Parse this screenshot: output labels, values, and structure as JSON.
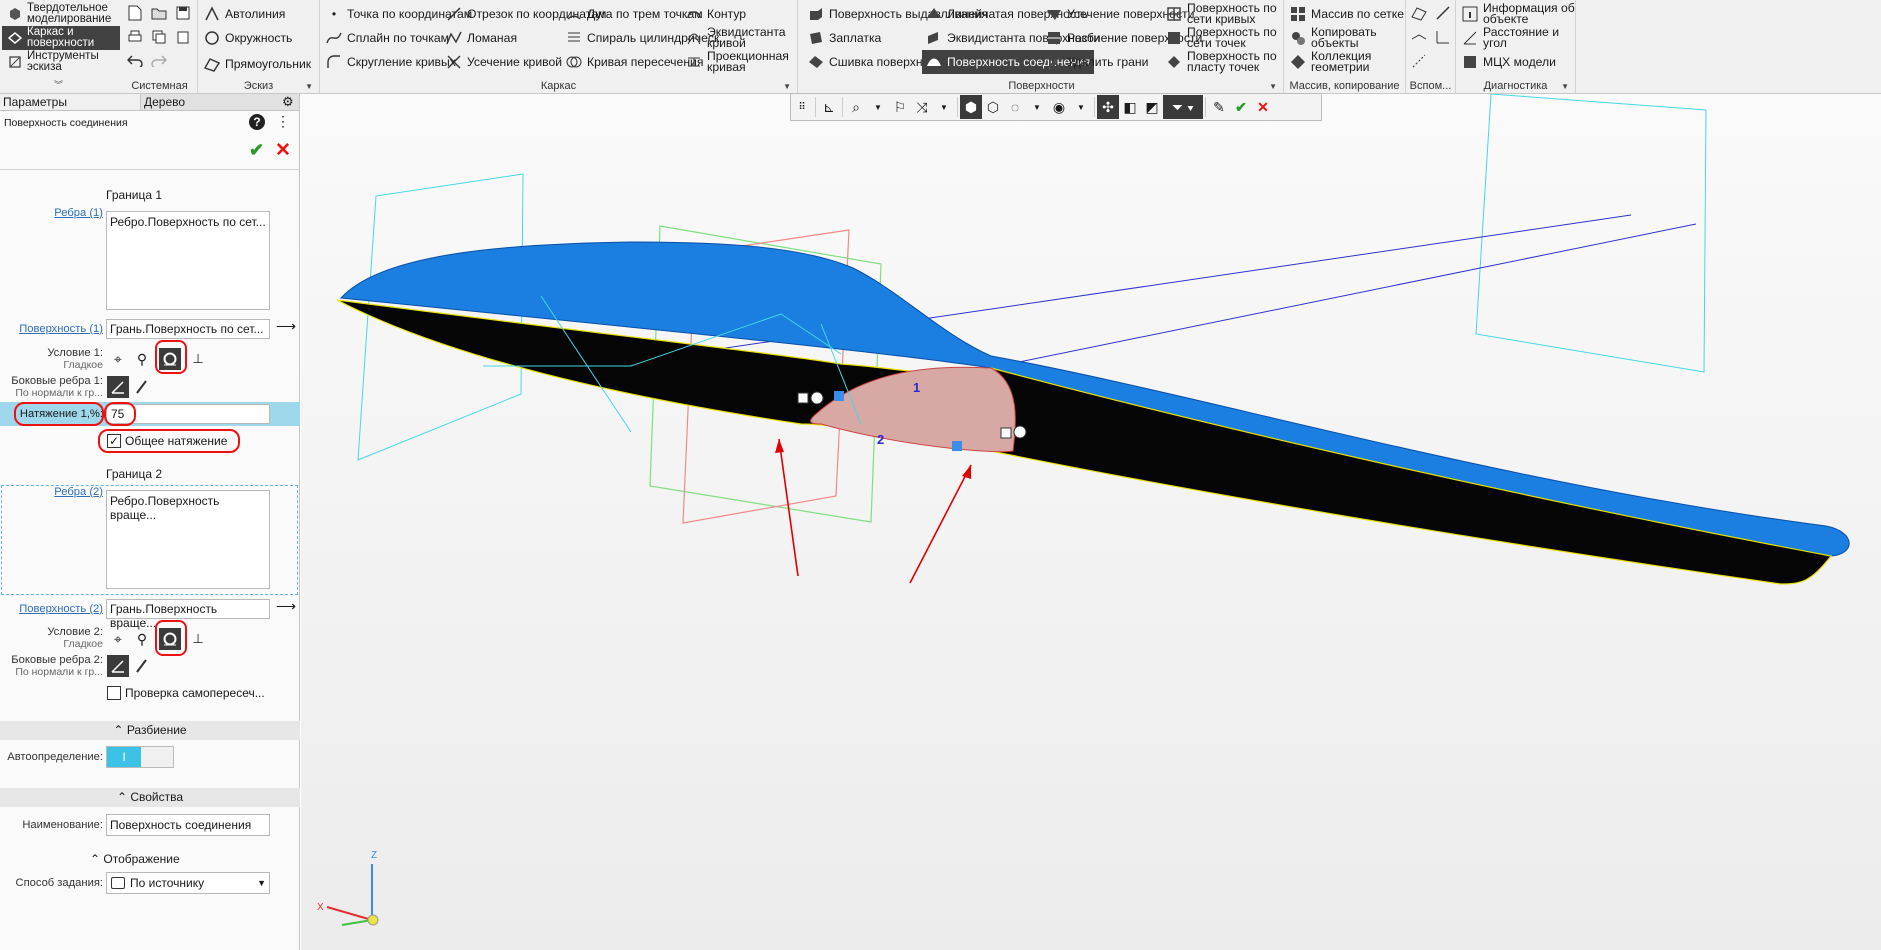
{
  "ribbon": {
    "modes": [
      "Твердотельное моделирование",
      "Каркас и поверхности",
      "Инструменты эскиза"
    ],
    "groups": {
      "system": "Системная",
      "sketch": "Эскиз",
      "frame": "Каркас",
      "surfaces": "Поверхности",
      "array": "Массив, копирование",
      "aux": "Вспом...",
      "diag": "Диагностика"
    },
    "sketch_buttons": [
      "Автолиния",
      "Окружность",
      "Прямоугольник"
    ],
    "frame_col1": [
      "Точка по координатам",
      "Сплайн по точкам",
      "Скругление кривых"
    ],
    "frame_col2": [
      "Отрезок по координатам",
      "Ломаная",
      "Усечение кривой"
    ],
    "frame_col3": [
      "Дуга по трем точкам",
      "Спираль цилиндрическ...",
      "Кривая пересечения"
    ],
    "frame_col4": [
      "Контур",
      "Эквидистанта кривой",
      "Проекционная кривая"
    ],
    "surf_col1": [
      "Поверхность выдавливания",
      "Заплатка",
      "Сшивка поверхностей"
    ],
    "surf_col2": [
      "Линейчатая поверхность",
      "Эквидистанта поверхности",
      "Поверхность соединения"
    ],
    "surf_col3": [
      "Усечение поверхности",
      "Разбиение поверхности",
      "Удалить грани"
    ],
    "surf_col4": [
      "Поверхность по сети кривых",
      "Поверхность по сети точек",
      "Поверхность по пласту точек"
    ],
    "array_buttons": [
      "Массив по сетке",
      "Копировать объекты",
      "Коллекция геометрии"
    ],
    "diag_buttons": [
      "Информация об объекте",
      "Расстояние и угол",
      "МЦХ модели"
    ]
  },
  "panel": {
    "tabs": [
      "Параметры",
      "Дерево"
    ],
    "title": "Поверхность соединения",
    "b1_header": "Граница 1",
    "edges1_label": "Ребра (1)",
    "edges1_value": "Ребро.Поверхность по сет...",
    "surface1_label": "Поверхность (1)",
    "surface1_value": "Грань.Поверхность по сет...",
    "cond1_label": "Условие 1:",
    "cond1_sub": "Гладкое",
    "side1_label": "Боковые ребра 1:",
    "side1_sub": "По нормали к гр...",
    "tension_label": "Натяжение 1,%:",
    "tension_value": "75",
    "common_tension": "Общее натяжение",
    "b2_header": "Граница 2",
    "edges2_label": "Ребра (2)",
    "edges2_value": "Ребро.Поверхность враще...",
    "surface2_label": "Поверхность (2)",
    "surface2_value": "Грань.Поверхность враще...",
    "cond2_label": "Условие 2:",
    "cond2_sub": "Гладкое",
    "side2_label": "Боковые ребра 2:",
    "side2_sub": "По нормали к гр...",
    "self_check": "Проверка самопересеч...",
    "sec_split": "Разбиение",
    "auto_label": "Автоопределение:",
    "sec_props": "Свойства",
    "name_label": "Наименование:",
    "name_value": "Поверхность соединения",
    "sec_display": "Отображение",
    "method_label": "Способ задания:",
    "method_value": "По источнику"
  },
  "viewport": {
    "label1": "1",
    "label2": "2",
    "axis_x": "X",
    "axis_z": "Z",
    "colors": {
      "blue_surface": "#1a7fe0",
      "annotation_red": "#e00000"
    }
  }
}
